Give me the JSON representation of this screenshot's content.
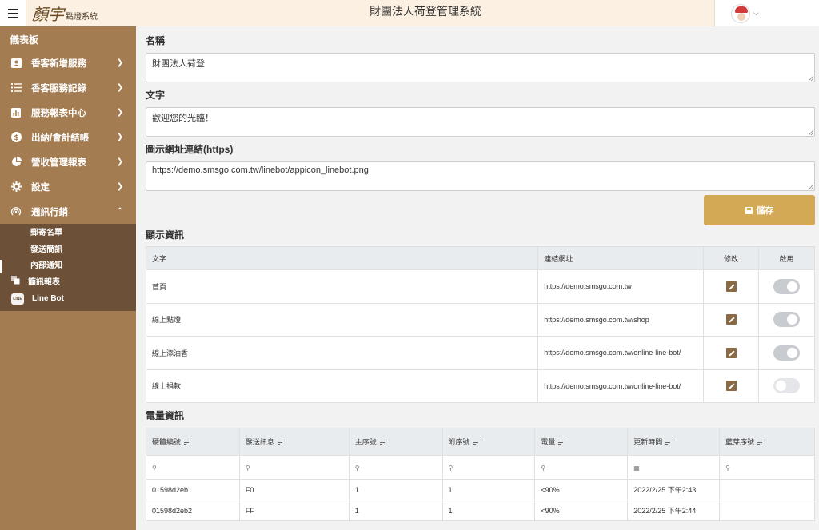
{
  "header": {
    "logo_mark": "顏宇",
    "logo_text": "點燈系統",
    "title": "財團法人荷登管理系統"
  },
  "sidebar": {
    "dashboard": "儀表板",
    "items": [
      {
        "label": "香客新增服務",
        "icon": "contact-card-icon",
        "expanded": false
      },
      {
        "label": "香客服務記錄",
        "icon": "list-icon",
        "expanded": false
      },
      {
        "label": "服務報表中心",
        "icon": "bar-chart-icon",
        "expanded": false
      },
      {
        "label": "出納/會計結帳",
        "icon": "dollar-icon",
        "expanded": false
      },
      {
        "label": "營收管理報表",
        "icon": "pie-chart-icon",
        "expanded": false
      },
      {
        "label": "設定",
        "icon": "gear-icon",
        "expanded": false
      },
      {
        "label": "通訊行銷",
        "icon": "broadcast-icon",
        "expanded": true
      }
    ],
    "sub_items": [
      {
        "label": "郵寄名單"
      },
      {
        "label": "發送簡訊"
      },
      {
        "label": "內部通知"
      },
      {
        "label": "簡訊報表"
      },
      {
        "label": "Line Bot"
      }
    ],
    "line_icon_text": "LINE"
  },
  "form": {
    "name_label": "名稱",
    "name_value": "財團法人荷登",
    "text_label": "文字",
    "text_value": "歡迎您的光臨！",
    "icon_url_label": "圖示網址連結(https)",
    "icon_url_value": "https://demo.smsgo.com.tw/linebot/appicon_linebot.png",
    "save_label": "儲存"
  },
  "display_section": {
    "title": "顯示資訊",
    "columns": [
      "文字",
      "連結網址",
      "修改",
      "啟用"
    ],
    "rows": [
      {
        "text": "首頁",
        "url": "https://demo.smsgo.com.tw",
        "enabled": true
      },
      {
        "text": "線上點燈",
        "url": "https://demo.smsgo.com.tw/shop",
        "enabled": true
      },
      {
        "text": "線上添油香",
        "url": "https://demo.smsgo.com.tw/online-line-bot/",
        "enabled": true
      },
      {
        "text": "線上捐款",
        "url": "https://demo.smsgo.com.tw/online-line-bot/",
        "enabled": false
      }
    ]
  },
  "power_section": {
    "title": "電量資訊",
    "columns": [
      "硬體編號",
      "發送訊息",
      "主序號",
      "附序號",
      "電量",
      "更新時間",
      "藍芽序號"
    ],
    "rows": [
      {
        "hw": "01598d2eb1",
        "msg": "F0",
        "main": "1",
        "sub": "1",
        "power": "<90%",
        "updated": "2022/2/25 下午2:43",
        "bt": ""
      },
      {
        "hw": "01598d2eb2",
        "msg": "FF",
        "main": "1",
        "sub": "1",
        "power": "<90%",
        "updated": "2022/2/25 下午2:44",
        "bt": ""
      }
    ]
  }
}
